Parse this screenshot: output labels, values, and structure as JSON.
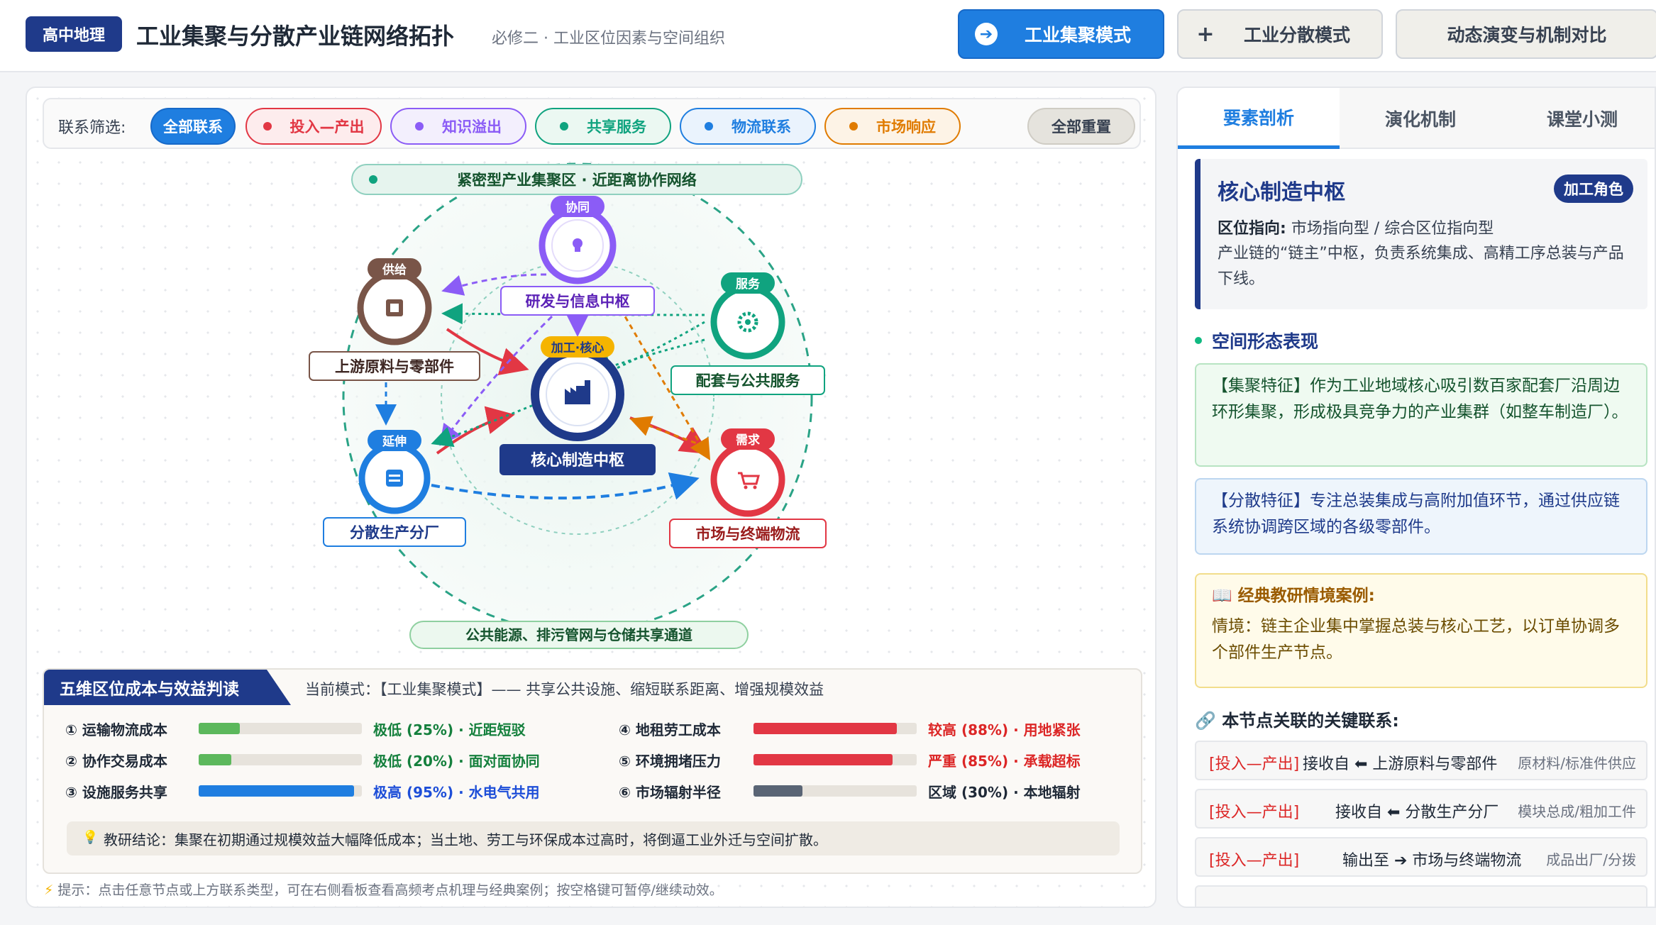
{
  "header": {
    "badge": "高中地理",
    "title": "工业集聚与分散产业链网络拓扑",
    "subtitle": "必修二 · 工业区位因素与空间组织",
    "modes": [
      {
        "label": "工业集聚模式",
        "icon": "arrow-right-icon"
      },
      {
        "label": "工业分散模式",
        "icon": "plus-icon"
      },
      {
        "label": "动态演变与机制对比"
      }
    ]
  },
  "filter": {
    "label": "联系筛选:",
    "chips": [
      "全部联系",
      "投入—产出",
      "知识溢出",
      "共享服务",
      "物流联系",
      "市场响应"
    ],
    "reset": "全部重置",
    "colors": {
      "active": "#1f7ee0",
      "input": "#e23744",
      "knowledge": "#8b5cf6",
      "service": "#10a37f",
      "logistics": "#1f7ee0",
      "market": "#e07b00"
    }
  },
  "network": {
    "top_label": "紧密型产业集聚区 · 近距离协作网络",
    "bottom_label": "公共能源、排污管网与仓储共享通道",
    "nodes": {
      "rnd": {
        "tag": "协同",
        "label": "研发与信息中枢",
        "icon": "lightbulb-icon",
        "color": "#8b5cf6"
      },
      "supply": {
        "tag": "供给",
        "label": "上游原料与零部件",
        "icon": "box-icon",
        "color": "#795548"
      },
      "service": {
        "tag": "服务",
        "label": "配套与公共服务",
        "icon": "gear-icon",
        "color": "#10a37f"
      },
      "core": {
        "tag": "加工·核心",
        "label": "核心制造中枢",
        "icon": "factory-icon",
        "color": "#1f3a8a"
      },
      "branch": {
        "tag": "延伸",
        "label": "分散生产分厂",
        "icon": "stack-icon",
        "color": "#1f7ee0"
      },
      "market": {
        "tag": "需求",
        "label": "市场与终端物流",
        "icon": "cart-icon",
        "color": "#e23744"
      }
    }
  },
  "cost": {
    "title": "五维区位成本与效益判读",
    "mode": "当前模式：【工业集聚模式】—— 共享公共设施、缩短联系距离、增强规模效益",
    "rows": [
      {
        "label": "① 运输物流成本",
        "value": "极低 (25%) · 近距短驳",
        "level": 0.25,
        "color": "#5cb85c"
      },
      {
        "label": "② 协作交易成本",
        "value": "极低 (20%) · 面对面协同",
        "level": 0.2,
        "color": "#5cb85c"
      },
      {
        "label": "③ 设施服务共享",
        "value": "极高 (95%) · 水电气共用",
        "level": 0.95,
        "color": "#1f7ee0"
      },
      {
        "label": "④ 地租劳工成本",
        "value": "较高 (88%) · 用地紧张",
        "level": 0.88,
        "color": "#e23744"
      },
      {
        "label": "⑤ 环境拥堵压力",
        "value": "严重 (85%) · 承载超标",
        "level": 0.85,
        "color": "#e23744"
      },
      {
        "label": "⑥ 市场辐射半径",
        "value": "区域 (30%) · 本地辐射",
        "level": 0.3,
        "color": "#5a6575"
      }
    ],
    "conclusion": "教研结论：集聚在初期通过规模效益大幅降低成本；当土地、劳工与环保成本过高时，将倒逼工业外迁与空间扩散。"
  },
  "hint": "提示：点击任意节点或上方联系类型，可在右侧看板查看高频考点机理与经典案例；按空格键可暂停/继续动效。",
  "side": {
    "tabs": [
      "要素剖析",
      "演化机制",
      "课堂小测"
    ],
    "node": {
      "title": "核心制造中枢",
      "role": "加工角色",
      "orient_label": "区位指向:",
      "orient": "市场指向型 / 综合区位指向型",
      "desc": "产业链的“链主”中枢，负责系统集成、高精工序总装与产品下线。"
    },
    "section": "空间形态表现",
    "cluster": "【集聚特征】作为工业地域核心吸引数百家配套厂沿周边环形集聚，形成极具竞争力的产业集群（如整车制造厂）。",
    "disperse": "【分散特征】专注总装集成与高附加值环节，通过供应链系统协调跨区域的各级零部件。",
    "case_title": "📖 经典教研情境案例:",
    "case": "情境：链主企业集中掌握总装与核心工艺，以订单协调多个部件生产节点。",
    "rel_title": "🔗 本节点关联的关键联系:",
    "relations": [
      {
        "type": "[投入—产出]",
        "main": "接收自 ⬅ 上游原料与零部件",
        "note": "原材料/标准件供应"
      },
      {
        "type": "[投入—产出]",
        "main": "接收自 ⬅ 分散生产分厂",
        "note": "模块总成/粗加工件"
      },
      {
        "type": "[投入—产出]",
        "main": "输出至 ➔ 市场与终端物流",
        "note": "成品出厂/分拨"
      }
    ]
  }
}
